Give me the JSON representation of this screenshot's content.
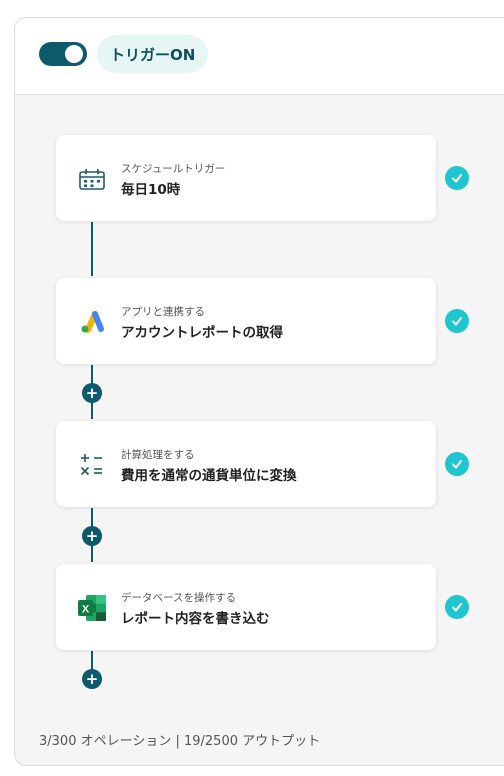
{
  "header": {
    "trigger_label": "トリガーON",
    "toggle_on": true
  },
  "steps": [
    {
      "category": "スケジュールトリガー",
      "title": "毎日10時",
      "icon": "calendar-clock-icon",
      "status": "done"
    },
    {
      "category": "アプリと連携する",
      "title": "アカウントレポートの取得",
      "icon": "google-ads-icon",
      "status": "done"
    },
    {
      "category": "計算処理をする",
      "title": "費用を通常の通貨単位に変換",
      "icon": "calculator-icon",
      "status": "done"
    },
    {
      "category": "データベースを操作する",
      "title": "レポート内容を書き込む",
      "icon": "excel-icon",
      "status": "done"
    }
  ],
  "add_step_symbol": "+",
  "footer": {
    "usage": "3/300 オペレーション | 19/2500 アウトプット"
  },
  "colors": {
    "accent": "#0e5a6d",
    "check": "#1fc5cf",
    "pill_bg": "#e6f6f5"
  }
}
